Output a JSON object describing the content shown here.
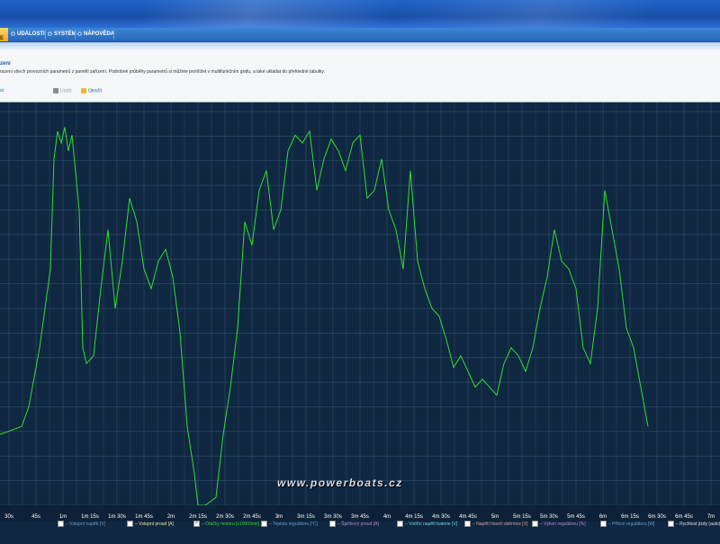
{
  "menu": {
    "active_label": "E",
    "items": [
      "UDÁLOSTI",
      "SYSTÉM",
      "NÁPOVĚDA"
    ]
  },
  "panel": {
    "title": "zení",
    "description": "razení všech provozních parametrů z paměti zařízení. Podrobné průběhy parametrů si můžete prohlížet v multifunkčním grafu, a také ukládat do přehledné tabulky.",
    "toolbar": {
      "left_label": "st",
      "save_label": "Uložit",
      "open_label": "Otevřít"
    }
  },
  "watermark": "www.powerboats.cz",
  "colors": {
    "series": "#33dd33",
    "grid": "#2a4a6a",
    "background": "#0f2740"
  },
  "chart_data": {
    "type": "line",
    "x_ticks": [
      "30s",
      "45s",
      "1m",
      "1m 15s",
      "1m 30s",
      "1m 45s",
      "2m",
      "2m 15s",
      "2m 30s",
      "2m 45s",
      "3m",
      "3m 15s",
      "3m 30s",
      "3m 45s",
      "4m",
      "4m 15s",
      "4m 30s",
      "4m 45s",
      "5m",
      "5m 15s",
      "5m 30s",
      "5m 45s",
      "6m",
      "6m 15s",
      "6m 30s",
      "6m 45s",
      "7m"
    ],
    "ylim": [
      0,
      100
    ],
    "legend": [
      {
        "label": "Vstupní napětí [V]",
        "checked": false,
        "color": "#6a9fd8"
      },
      {
        "label": "Vstupní proud [A]",
        "checked": false,
        "color": "#e8e8a0"
      },
      {
        "label": "Otáčky motoru [x1000/min]",
        "checked": true,
        "color": "#33dd33"
      },
      {
        "label": "Teplota regulátoru [°C]",
        "checked": false,
        "color": "#6a9fd8"
      },
      {
        "label": "Špičkový proud [A]",
        "checked": false,
        "color": "#b98ad8"
      },
      {
        "label": "Vnitřní napětí baterie [V]",
        "checked": false,
        "color": "#6ad8d8"
      },
      {
        "label": "Napětí hlavní sběrnice [V]",
        "checked": false,
        "color": "#d8a0a0"
      },
      {
        "label": "Výkon regulátoru [%]",
        "checked": false,
        "color": "#b98ad8"
      },
      {
        "label": "Příkon regulátoru [W]",
        "checked": false,
        "color": "#6a9fd8"
      },
      {
        "label": "Rychlost jízdy (auto) [km/h]",
        "checked": false,
        "color": "#e0e0e0"
      }
    ],
    "series": [
      {
        "name": "Otáčky motoru [x1000/min]",
        "points": [
          [
            0,
            18
          ],
          [
            0.03,
            20
          ],
          [
            0.04,
            25
          ],
          [
            0.055,
            40
          ],
          [
            0.07,
            60
          ],
          [
            0.075,
            88
          ],
          [
            0.08,
            95
          ],
          [
            0.085,
            92
          ],
          [
            0.09,
            96
          ],
          [
            0.095,
            90
          ],
          [
            0.1,
            94
          ],
          [
            0.11,
            75
          ],
          [
            0.115,
            40
          ],
          [
            0.12,
            36
          ],
          [
            0.13,
            38
          ],
          [
            0.14,
            55
          ],
          [
            0.15,
            70
          ],
          [
            0.16,
            50
          ],
          [
            0.17,
            62
          ],
          [
            0.175,
            70
          ],
          [
            0.18,
            78
          ],
          [
            0.19,
            72
          ],
          [
            0.2,
            60
          ],
          [
            0.21,
            55
          ],
          [
            0.22,
            62
          ],
          [
            0.23,
            65
          ],
          [
            0.24,
            58
          ],
          [
            0.25,
            44
          ],
          [
            0.26,
            20
          ],
          [
            0.27,
            8
          ],
          [
            0.275,
            0
          ],
          [
            0.285,
            0
          ],
          [
            0.3,
            2
          ],
          [
            0.31,
            18
          ],
          [
            0.32,
            30
          ],
          [
            0.33,
            45
          ],
          [
            0.34,
            72
          ],
          [
            0.35,
            66
          ],
          [
            0.36,
            80
          ],
          [
            0.37,
            85
          ],
          [
            0.38,
            70
          ],
          [
            0.39,
            75
          ],
          [
            0.4,
            90
          ],
          [
            0.41,
            94
          ],
          [
            0.42,
            92
          ],
          [
            0.43,
            95
          ],
          [
            0.44,
            80
          ],
          [
            0.45,
            88
          ],
          [
            0.46,
            93
          ],
          [
            0.47,
            90
          ],
          [
            0.48,
            85
          ],
          [
            0.49,
            92
          ],
          [
            0.5,
            94
          ],
          [
            0.51,
            78
          ],
          [
            0.52,
            80
          ],
          [
            0.53,
            88
          ],
          [
            0.54,
            75
          ],
          [
            0.55,
            70
          ],
          [
            0.56,
            60
          ],
          [
            0.57,
            85
          ],
          [
            0.58,
            62
          ],
          [
            0.59,
            55
          ],
          [
            0.6,
            50
          ],
          [
            0.61,
            48
          ],
          [
            0.62,
            42
          ],
          [
            0.63,
            35
          ],
          [
            0.64,
            38
          ],
          [
            0.65,
            34
          ],
          [
            0.66,
            30
          ],
          [
            0.67,
            32
          ],
          [
            0.68,
            30
          ],
          [
            0.69,
            28
          ],
          [
            0.7,
            36
          ],
          [
            0.71,
            40
          ],
          [
            0.72,
            38
          ],
          [
            0.73,
            34
          ],
          [
            0.74,
            40
          ],
          [
            0.75,
            50
          ],
          [
            0.76,
            58
          ],
          [
            0.77,
            70
          ],
          [
            0.78,
            62
          ],
          [
            0.79,
            60
          ],
          [
            0.8,
            55
          ],
          [
            0.81,
            40
          ],
          [
            0.82,
            36
          ],
          [
            0.83,
            50
          ],
          [
            0.84,
            80
          ],
          [
            0.85,
            70
          ],
          [
            0.86,
            60
          ],
          [
            0.87,
            45
          ],
          [
            0.88,
            40
          ],
          [
            0.89,
            30
          ],
          [
            0.9,
            20
          ]
        ]
      }
    ]
  }
}
